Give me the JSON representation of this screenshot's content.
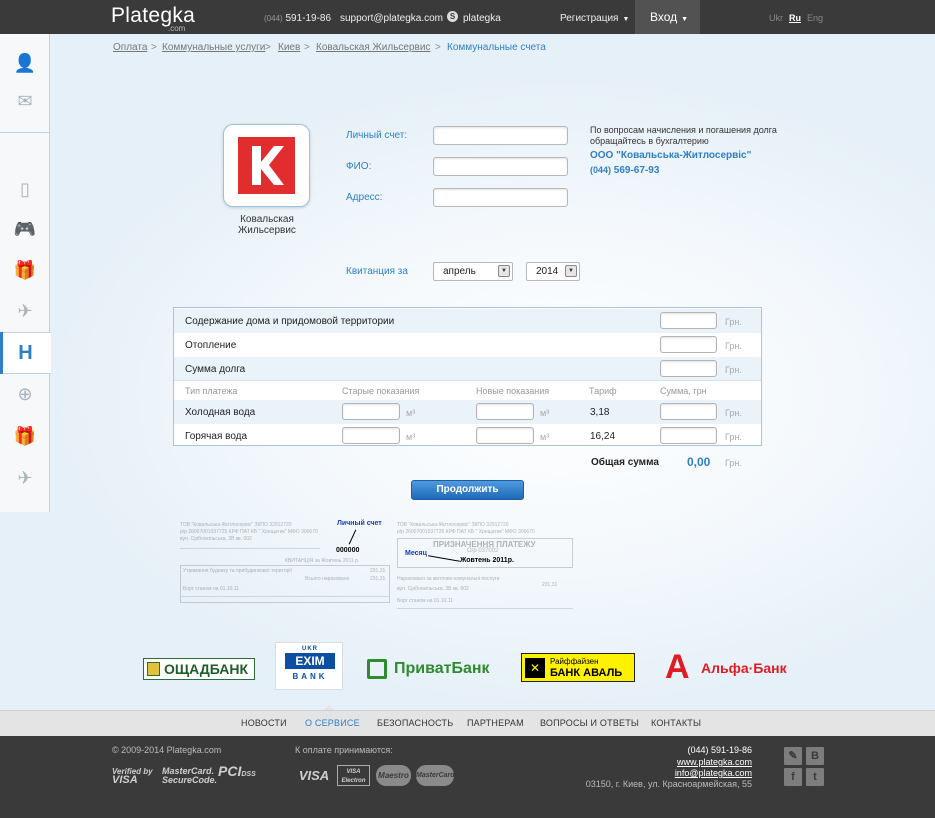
{
  "header": {
    "logo": "Plategka",
    "logo_sub": ".com",
    "phone_code": "(044)",
    "phone": "591-19-86",
    "email": "support@plategka.com",
    "skype": "plategka",
    "register": "Регистрация",
    "login": "Вход",
    "langs": [
      "Ukr",
      "Ru",
      "Eng"
    ],
    "active_lang": "Ru"
  },
  "sidebar": {
    "icons": [
      "user-icon",
      "mail-icon",
      "phone-icon",
      "gamepad-icon",
      "gift-icon",
      "plane-icon",
      "hotel-icon",
      "globe-icon",
      "gift-icon",
      "plane-icon"
    ],
    "active_glyph": "H"
  },
  "breadcrumb": {
    "items": [
      "Оплата",
      "Коммунальные услуги",
      "Киев",
      "Ковальская Жильсервис"
    ],
    "current": "Коммунальные счета"
  },
  "company": {
    "name_line1": "Ковальская",
    "name_line2": "Жильсервис",
    "logo_letter": "K",
    "logo_color": "#e22d2e"
  },
  "form": {
    "account_label": "Личный счет:",
    "fio_label": "ФИО:",
    "address_label": "Адресс:",
    "receipt_label": "Квитанция за",
    "month": "апрель",
    "year": "2014"
  },
  "info": {
    "text": "По вопросам начисления и погашения долга обращайтесь в бухгалтерию",
    "company": "ООО \"Ковальська-Житлосервіс\"",
    "phone_code": "(044)",
    "phone": "569-67-93"
  },
  "table": {
    "rows_top": [
      "Содержание дома и придомовой территории",
      "Отопление",
      "Сумма долга"
    ],
    "unit_grn": "Грн.",
    "unit_m3": "м³",
    "headers": [
      "Тип платежа",
      "Старые показания",
      "Новые показания",
      "Тариф",
      "Сумма, грн"
    ],
    "meters": [
      {
        "label": "Холодная вода",
        "tariff": "3,18"
      },
      {
        "label": "Горячая вода",
        "tariff": "16,24"
      }
    ],
    "total_label": "Общая сумма",
    "total_value": "0,00"
  },
  "submit": "Продолжить",
  "receipt": {
    "ann_account": "Личный счет",
    "ann_month": "Месяц",
    "account_value": "000000",
    "month_value": "Жовтень 2011р.",
    "title": "ПРИЗНАЧЕННЯ ПЛАТЕЖУ",
    "org": "ТОВ \"Ковальська-Житлосервіс\" ЗКПО 32912720",
    "bank_line": "р/р 26007001037725 КРФ ПАТ КБ \" Хрещатик\" МФО 300670",
    "addr": "вул. Срібнокільська, 3В кв. 002",
    "kv": "КВИТАНЦІЯ за Жовтень 2011 р.",
    "op": "О/р 037002",
    "line1": "Утримання будинку та прибудинкової території",
    "line2": "Всього нараховано",
    "line3": "Борг станом на 01.10.11",
    "line4": "Нараховано за житлово-комунальні послуги",
    "v1": "231,31",
    "v2": "231,31"
  },
  "banks": {
    "oschad": "ОЩАДБАНК",
    "exim_top": "UKR",
    "exim_mid": "EXIM",
    "exim_bot": "BANK",
    "privat": "ПриватБанк",
    "raif_top": "Райффайзен",
    "raif_bottom": "БАНК АВАЛЬ",
    "alfa": "Альфа·Банк",
    "alfa_glyph": "А"
  },
  "nav": [
    "НОВОСТИ",
    "О СЕРВИСЕ",
    "БЕЗОПАСНОСТЬ",
    "ПАРТНЕРАМ",
    "ВОПРОСЫ И ОТВЕТЫ",
    "КОНТАКТЫ"
  ],
  "nav_active": "О СЕРВИСЕ",
  "footer": {
    "copyright": "© 2009-2014 Plategka.com",
    "accept": "К оплате принимаются:",
    "verified": "Verified by",
    "visa": "VISA",
    "mastercard": "MasterCard.",
    "securecode": "SecureCode.",
    "pci": "PCI",
    "dss": "DSS",
    "cards": [
      "VISA",
      "VISA Electron",
      "Maestro",
      "MasterCard"
    ],
    "phone": "(044) 591-19-86",
    "site": "www.plategka.com",
    "email": "info@plategka.com",
    "address": "03150, г. Киев, ул. Красноармейская, 55",
    "social": [
      "pencil-icon",
      "vk-icon",
      "facebook-icon",
      "twitter-icon"
    ],
    "social_glyphs": [
      "✎",
      "В",
      "f",
      "t"
    ]
  }
}
